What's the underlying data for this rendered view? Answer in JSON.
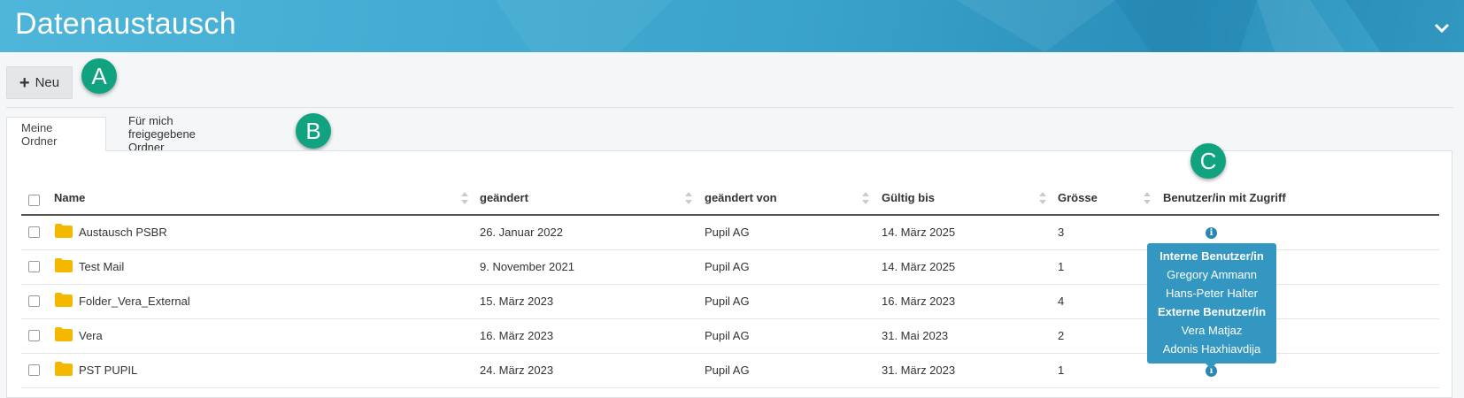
{
  "header": {
    "title": "Datenaustausch",
    "collapse_icon": "chevron-down-icon"
  },
  "toolbar": {
    "new_label": "Neu",
    "new_icon": "plus-icon"
  },
  "annotations": [
    "A",
    "B",
    "C"
  ],
  "tabs": [
    {
      "label": "Meine Ordner",
      "active": true
    },
    {
      "label": "Für mich freigegebene Ordner",
      "active": false
    }
  ],
  "table": {
    "columns": [
      "Name",
      "geändert",
      "geändert von",
      "Gültig bis",
      "Grösse",
      "Benutzer/in mit Zugriff"
    ],
    "rows": [
      {
        "name": "Austausch PSBR",
        "changed": "26. Januar 2022",
        "changed_by": "Pupil AG",
        "valid_until": "14. März 2025",
        "size": "3"
      },
      {
        "name": "Test Mail",
        "changed": "9. November 2021",
        "changed_by": "Pupil AG",
        "valid_until": "14. März 2025",
        "size": "1"
      },
      {
        "name": "Folder_Vera_External",
        "changed": "15. März 2023",
        "changed_by": "Pupil AG",
        "valid_until": "16. März 2023",
        "size": "4"
      },
      {
        "name": "Vera",
        "changed": "16. März 2023",
        "changed_by": "Pupil AG",
        "valid_until": "31. Mai 2023",
        "size": "2"
      },
      {
        "name": "PST PUPIL",
        "changed": "24. März 2023",
        "changed_by": "Pupil AG",
        "valid_until": "31. März 2023",
        "size": "1"
      }
    ]
  },
  "tooltip": {
    "internal_header": "Interne Benutzer/in",
    "internal_users": [
      "Gregory Ammann",
      "Hans-Peter Halter"
    ],
    "external_header": "Externe Benutzer/in",
    "external_users": [
      "Vera Matjaz",
      "Adonis Haxhiavdija"
    ]
  },
  "colors": {
    "header": "#3aa3cb",
    "badge": "#11a27f",
    "folder": "#f5b800",
    "tooltip": "#3497c2",
    "info": "#2a87b2"
  }
}
